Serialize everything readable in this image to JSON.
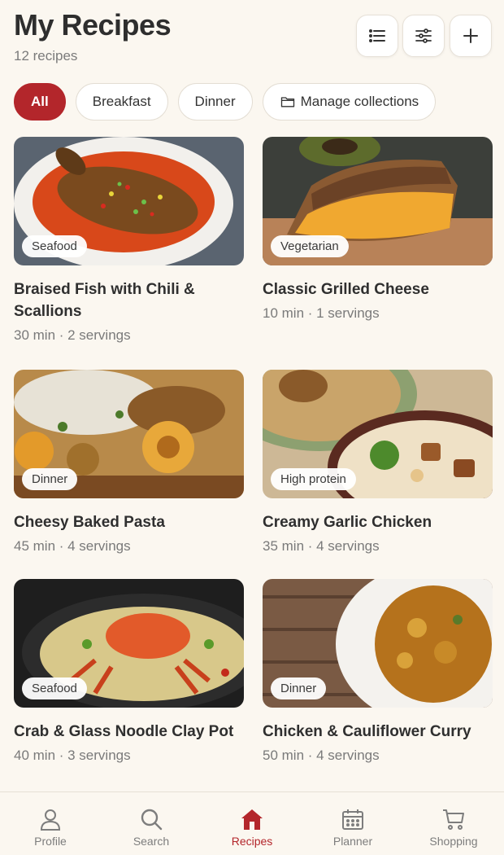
{
  "header": {
    "title": "My Recipes",
    "subtitle": "12 recipes",
    "buttons": [
      {
        "icon": "list-icon"
      },
      {
        "icon": "sliders-icon"
      },
      {
        "icon": "plus-icon"
      }
    ]
  },
  "filters": {
    "chips": [
      {
        "label": "All",
        "active": true
      },
      {
        "label": "Breakfast",
        "active": false
      },
      {
        "label": "Dinner",
        "active": false
      },
      {
        "label": "Manage collections",
        "active": false,
        "icon": "folder-icon"
      }
    ]
  },
  "recipes": [
    {
      "title": "Braised Fish with Chili & Scallions",
      "tag": "Seafood",
      "meta": "30 min · 2 servings"
    },
    {
      "title": "Classic Grilled Cheese",
      "tag": "Vegetarian",
      "meta": "10 min · 1 servings"
    },
    {
      "title": "Cheesy Baked Pasta",
      "tag": "Dinner",
      "meta": "45 min · 4 servings"
    },
    {
      "title": "Creamy Garlic Chicken",
      "tag": "High protein",
      "meta": "35 min · 4 servings"
    },
    {
      "title": "Crab & Glass Noodle Clay Pot",
      "tag": "Seafood",
      "meta": "40 min · 3 servings"
    },
    {
      "title": "Chicken & Cauliflower Curry",
      "tag": "Dinner",
      "meta": "50 min · 4 servings"
    }
  ],
  "tabbar": {
    "tabs": [
      {
        "label": "Profile",
        "icon": "person-icon",
        "active": false
      },
      {
        "label": "Search",
        "icon": "search-icon",
        "active": false
      },
      {
        "label": "Recipes",
        "icon": "home-icon",
        "active": true
      },
      {
        "label": "Planner",
        "icon": "calendar-icon",
        "active": false
      },
      {
        "label": "Shopping",
        "icon": "cart-icon",
        "active": false
      }
    ]
  },
  "colors": {
    "accent": "#b3262b",
    "background": "#fbf7f0"
  }
}
